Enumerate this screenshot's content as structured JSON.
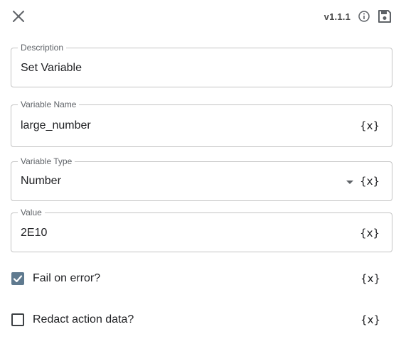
{
  "header": {
    "version": "v1.1.1",
    "close_icon": "close-icon",
    "info_icon": "info-icon",
    "save_icon": "save-icon"
  },
  "fields": {
    "description": {
      "label": "Description",
      "value": "Set Variable"
    },
    "variable_name": {
      "label": "Variable Name",
      "value": "large_number",
      "var_button": "{x}"
    },
    "variable_type": {
      "label": "Variable Type",
      "value": "Number",
      "var_button": "{x}"
    },
    "value": {
      "label": "Value",
      "value": "2E10",
      "var_button": "{x}"
    }
  },
  "options": {
    "fail_on_error": {
      "label": "Fail on error?",
      "checked": true,
      "var_button": "{x}"
    },
    "redact_action_data": {
      "label": "Redact action data?",
      "checked": false,
      "var_button": "{x}"
    }
  },
  "colors": {
    "checkbox_checked": "#5f7a8f",
    "border": "#c4c4c4",
    "label": "#5f6368"
  }
}
